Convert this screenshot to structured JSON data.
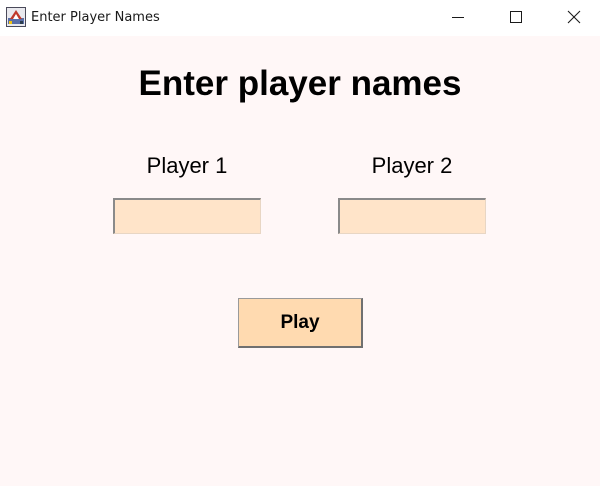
{
  "window": {
    "title": "Enter Player Names",
    "icon": "java-app-icon",
    "controls": [
      "minimize-icon",
      "maximize-icon",
      "close-icon"
    ]
  },
  "form": {
    "heading": "Enter player names",
    "player1": {
      "label": "Player 1",
      "value": ""
    },
    "player2": {
      "label": "Player 2",
      "value": ""
    },
    "play_label": "Play"
  },
  "colors": {
    "background": "#fff7f7",
    "input_fill": "#ffe4c9",
    "button_fill": "#ffdab0"
  }
}
